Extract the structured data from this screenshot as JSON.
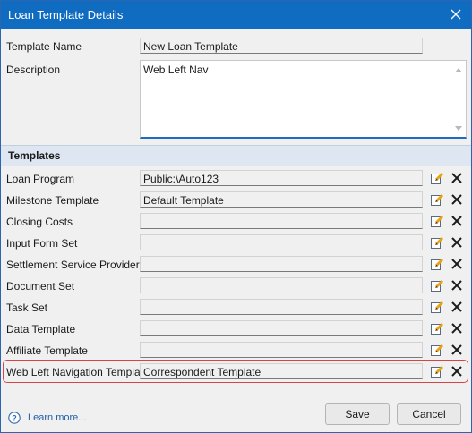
{
  "window": {
    "title": "Loan Template Details"
  },
  "form": {
    "template_name_label": "Template Name",
    "template_name_value": "New Loan Template",
    "description_label": "Description",
    "description_value": "Web Left Nav"
  },
  "templates_section": {
    "heading": "Templates",
    "rows": [
      {
        "label": "Loan Program",
        "value": "Public:\\Auto123"
      },
      {
        "label": "Milestone Template",
        "value": "Default Template"
      },
      {
        "label": "Closing Costs",
        "value": ""
      },
      {
        "label": "Input Form Set",
        "value": ""
      },
      {
        "label": "Settlement Service Providers",
        "value": ""
      },
      {
        "label": "Document Set",
        "value": ""
      },
      {
        "label": "Task Set",
        "value": ""
      },
      {
        "label": "Data Template",
        "value": ""
      },
      {
        "label": "Affiliate Template",
        "value": ""
      },
      {
        "label": "Web Left Navigation Template",
        "value": "Correspondent Template"
      }
    ]
  },
  "footer": {
    "learn_more": "Learn more...",
    "save_label": "Save",
    "cancel_label": "Cancel"
  },
  "colors": {
    "titlebar": "#0f6cc1",
    "section_header": "#dde6f1",
    "highlight_border": "#d64545",
    "link": "#1f5fa8"
  },
  "icons": {
    "edit": "edit-icon",
    "clear": "clear-x-icon",
    "close": "close-icon",
    "help": "help-circle-icon"
  }
}
